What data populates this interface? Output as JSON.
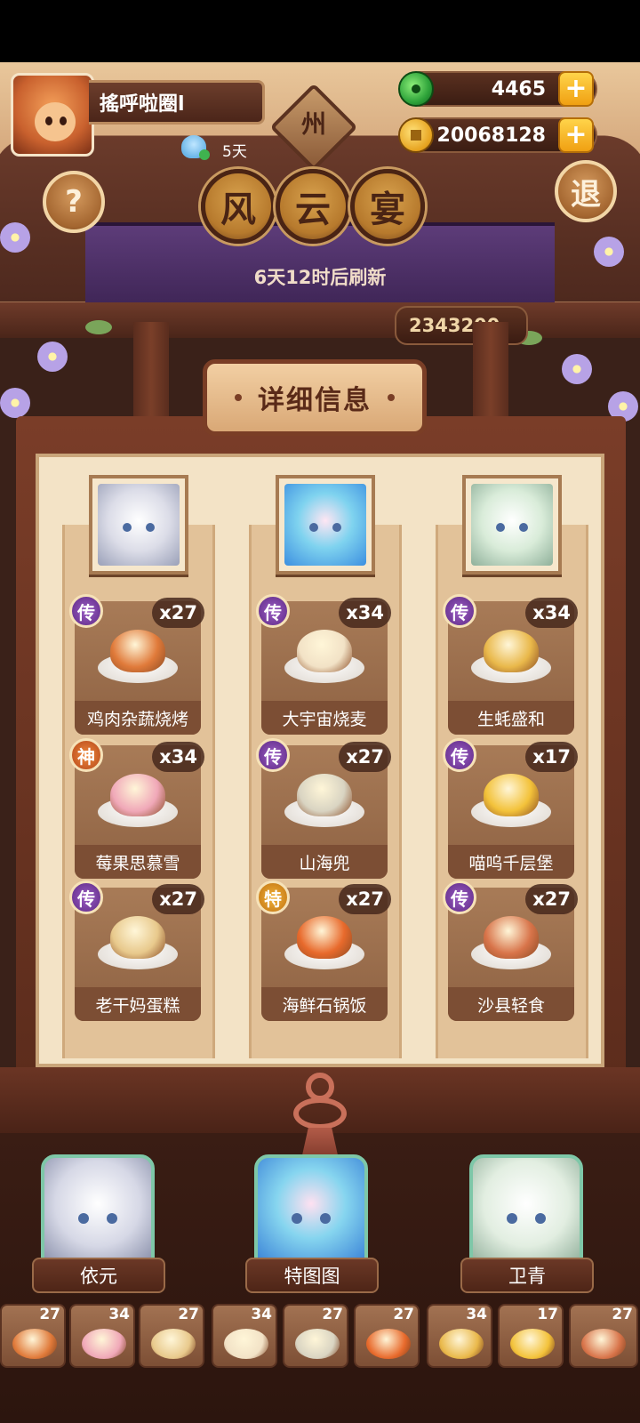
{
  "player": {
    "name": "搖呼啦圈l",
    "streak": "5天"
  },
  "sign": "州",
  "currency": {
    "jade": "4465",
    "coins": "20068128"
  },
  "buttons": {
    "help": "?",
    "exit": "退"
  },
  "title": [
    "风",
    "云",
    "宴"
  ],
  "refresh": "6天12时后刷新",
  "score": "2343200",
  "info_header": "详细信息",
  "columns": [
    {
      "dishes": [
        {
          "name": "鸡肉杂蔬烧烤",
          "badge": "传",
          "count": "x27",
          "color": "#e07a3a"
        },
        {
          "name": "莓果思慕雪",
          "badge": "神",
          "count": "x34",
          "color": "#f0a8b8"
        },
        {
          "name": "老干妈蛋糕",
          "badge": "传",
          "count": "x27",
          "color": "#e8c98c"
        }
      ]
    },
    {
      "dishes": [
        {
          "name": "大宇宙烧麦",
          "badge": "传",
          "count": "x34",
          "color": "#f2e2c6"
        },
        {
          "name": "山海兜",
          "badge": "传",
          "count": "x27",
          "color": "#d9d4c2"
        },
        {
          "name": "海鲜石锅饭",
          "badge": "特",
          "count": "x27",
          "color": "#e86a2c"
        }
      ]
    },
    {
      "dishes": [
        {
          "name": "生蚝盛和",
          "badge": "传",
          "count": "x34",
          "color": "#e9b84a"
        },
        {
          "name": "喵呜千层堡",
          "badge": "传",
          "count": "x17",
          "color": "#f3c23a"
        },
        {
          "name": "沙县轻食",
          "badge": "传",
          "count": "x27",
          "color": "#d8744a"
        }
      ]
    }
  ],
  "characters": [
    "依元",
    "特图图",
    "卫青"
  ],
  "strip": [
    {
      "count": "27",
      "color": "#e07a3a"
    },
    {
      "count": "34",
      "color": "#f0a8b8"
    },
    {
      "count": "27",
      "color": "#e8c98c"
    },
    {
      "count": "34",
      "color": "#f2e2c6"
    },
    {
      "count": "27",
      "color": "#d9d4c2"
    },
    {
      "count": "27",
      "color": "#e86a2c"
    },
    {
      "count": "34",
      "color": "#e9b84a"
    },
    {
      "count": "17",
      "color": "#f3c23a"
    },
    {
      "count": "27",
      "color": "#d8744a"
    }
  ]
}
